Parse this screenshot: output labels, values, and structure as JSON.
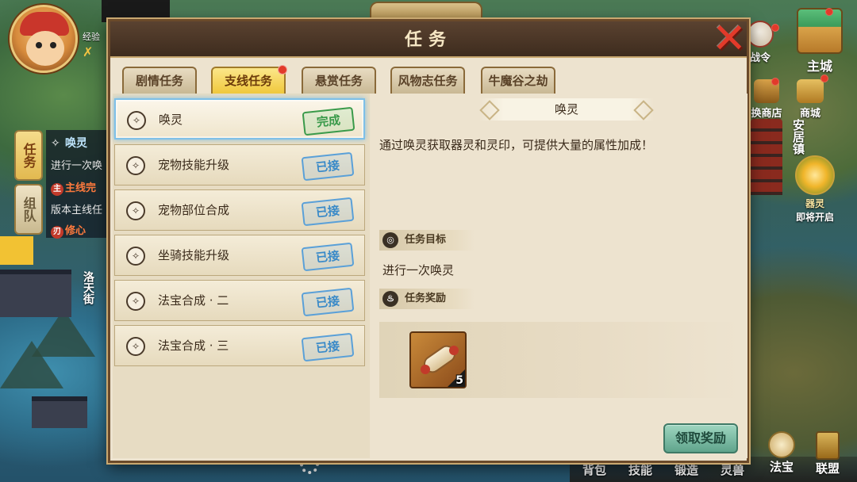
{
  "hud": {
    "exp_label": "经验",
    "side_tabs": [
      "任务",
      "组队"
    ],
    "tracker": {
      "title": "唤灵",
      "subtitle": "进行一次唤",
      "main_line": "主线完",
      "version": "版本主线任",
      "xiu_line": "修心",
      "main_icon": "主",
      "xiu_icon": "刃"
    },
    "street_sign": "洛天街",
    "town_sign": "安居镇",
    "right_buttons": {
      "zhanling": "战令",
      "zhucheng": "主城",
      "huanshang": "换商店",
      "shangcheng": "商城",
      "qiling": "器灵",
      "qiling_sub": "即将开启"
    },
    "bottom_bar": [
      "背包",
      "技能",
      "锻造",
      "灵兽",
      "法宝",
      "联盟"
    ]
  },
  "dialog": {
    "title": "任务",
    "close_icon": "close-x-icon",
    "tabs": [
      {
        "label": "剧情任务",
        "active": false,
        "dot": false
      },
      {
        "label": "支线任务",
        "active": true,
        "dot": true
      },
      {
        "label": "悬赏任务",
        "active": false,
        "dot": false
      },
      {
        "label": "风物志任务",
        "active": false,
        "dot": false
      },
      {
        "label": "牛魔谷之劫",
        "active": false,
        "dot": false
      }
    ],
    "tasks": [
      {
        "name": "唤灵",
        "status": "完成",
        "status_kind": "done",
        "selected": true
      },
      {
        "name": "宠物技能升级",
        "status": "已接",
        "status_kind": "accepted"
      },
      {
        "name": "宠物部位合成",
        "status": "已接",
        "status_kind": "accepted"
      },
      {
        "name": "坐骑技能升级",
        "status": "已接",
        "status_kind": "accepted"
      },
      {
        "name": "法宝合成 · 二",
        "status": "已接",
        "status_kind": "accepted"
      },
      {
        "name": "法宝合成 · 三",
        "status": "已接",
        "status_kind": "accepted"
      }
    ],
    "detail": {
      "title": "唤灵",
      "description": "通过唤灵获取器灵和灵印，可提供大量的属性加成！",
      "objective_header": "任务目标",
      "objective": "进行一次唤灵",
      "reward_header": "任务奖励",
      "reward_count": "5",
      "claim_button": "领取奖励"
    }
  },
  "colors": {
    "tab_active": "#f0c83c",
    "stamp_done": "#3a9a4a",
    "stamp_accepted": "#3a8ac8",
    "claim_button": "#5fa48c",
    "close": "#e23a2a"
  }
}
